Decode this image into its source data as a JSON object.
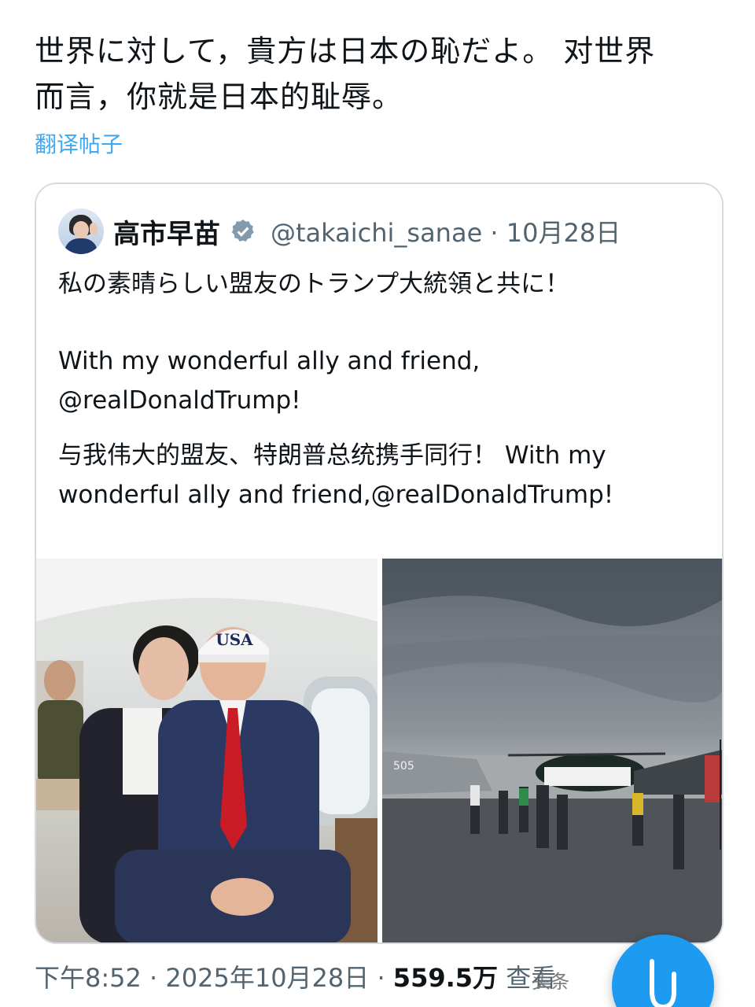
{
  "post": {
    "text_line1": "世界に対して，貴方は日本の恥だよ。 对世界",
    "text_line2": "而言，你就是日本的耻辱。",
    "translate_label": "翻译帖子"
  },
  "quote": {
    "author_name": "高市早苗",
    "handle": "@takaichi_sanae",
    "date": "10月28日",
    "line_jp": "私の素晴らしい盟友のトランプ大統領と共に！",
    "line_en1": "With my wonderful ally and friend,",
    "line_en2": "@realDonaldTrump!",
    "line_zh1": "与我伟大的盟友、特朗普总统携手同行！ With my",
    "line_zh2": "wonderful ally and friend,@realDonaldTrump!"
  },
  "media": {
    "cap_text": "USA",
    "jet_number": "505"
  },
  "meta": {
    "time": "下午8:52",
    "full_date": "2025年10月28日",
    "views": "559.5万",
    "views_label": "查看"
  },
  "watermark": "头条",
  "colors": {
    "accent": "#1d9bf0",
    "muted": "#536471"
  },
  "icons": {
    "verified": "verified-badge-icon",
    "compose": "compose-icon"
  }
}
